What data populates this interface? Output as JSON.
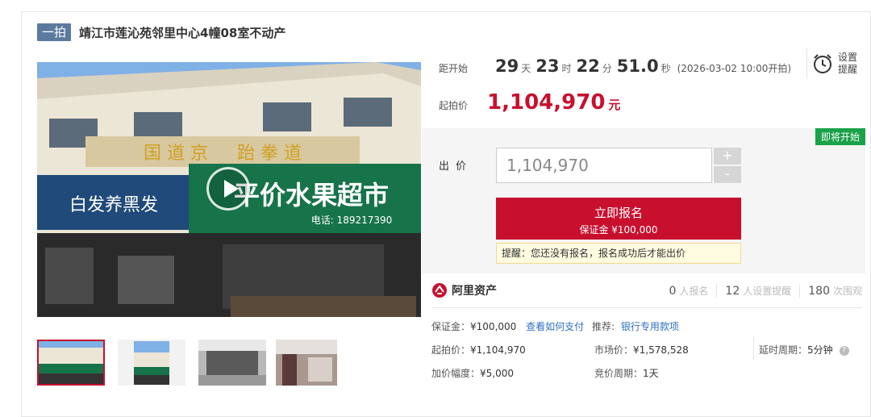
{
  "title": {
    "badge": "一拍",
    "text": "靖江市莲沁苑邻里中心4幢08室不动产"
  },
  "photo": {
    "shop_left": "白发养黑发",
    "shop_right": "平价水果超市",
    "shop_top": "国 道 京 　 跆 拳 道",
    "phone": "电话: 18921739​0"
  },
  "countdown": {
    "label": "距开始",
    "days": "29",
    "days_unit": "天",
    "hours": "23",
    "hours_unit": "时",
    "minutes": "22",
    "minutes_unit": "分",
    "seconds": "51.0",
    "seconds_unit": "秒",
    "start_date": "(2026-03-02 10:00开拍)"
  },
  "remind": {
    "label": "设置提醒",
    "icon": "alarm-clock-icon"
  },
  "start_price": {
    "label": "起拍价",
    "value": "1,104,970",
    "unit": "元"
  },
  "bid": {
    "status_badge": "即将开始",
    "label": "出价",
    "input_value": "1,104,970",
    "plus": "+",
    "minus": "-",
    "signup_label": "立即报名",
    "deposit_label": "保证金 ¥100,000",
    "notice": "提醒：您还没有报名，报名成功后才能出价"
  },
  "ali": {
    "logo_text": "阿里资产",
    "stats": [
      {
        "num": "0",
        "label": "人报名"
      },
      {
        "num": "12",
        "label": "人设置提醒"
      },
      {
        "num": "180",
        "label": "次围观"
      }
    ]
  },
  "details": {
    "deposit_key": "保证金",
    "deposit_val": "¥100,000",
    "pay_link": "查看如何支付",
    "recommend_key": "推荐:",
    "recommend_link": "银行专用款项",
    "start_key": "起拍价",
    "start_val": "¥1,104,970",
    "market_key": "市场价",
    "market_val": "¥1,578,528",
    "delay_key": "延时周期",
    "delay_val": "5分钟",
    "increment_key": "加价幅度",
    "increment_val": "¥5,000",
    "cycle_key": "竞价周期",
    "cycle_val": "1天"
  },
  "colors": {
    "accent": "#c8102e",
    "badge": "#5b7a9e",
    "status": "#1aa14a",
    "link": "#2d6fc0"
  }
}
